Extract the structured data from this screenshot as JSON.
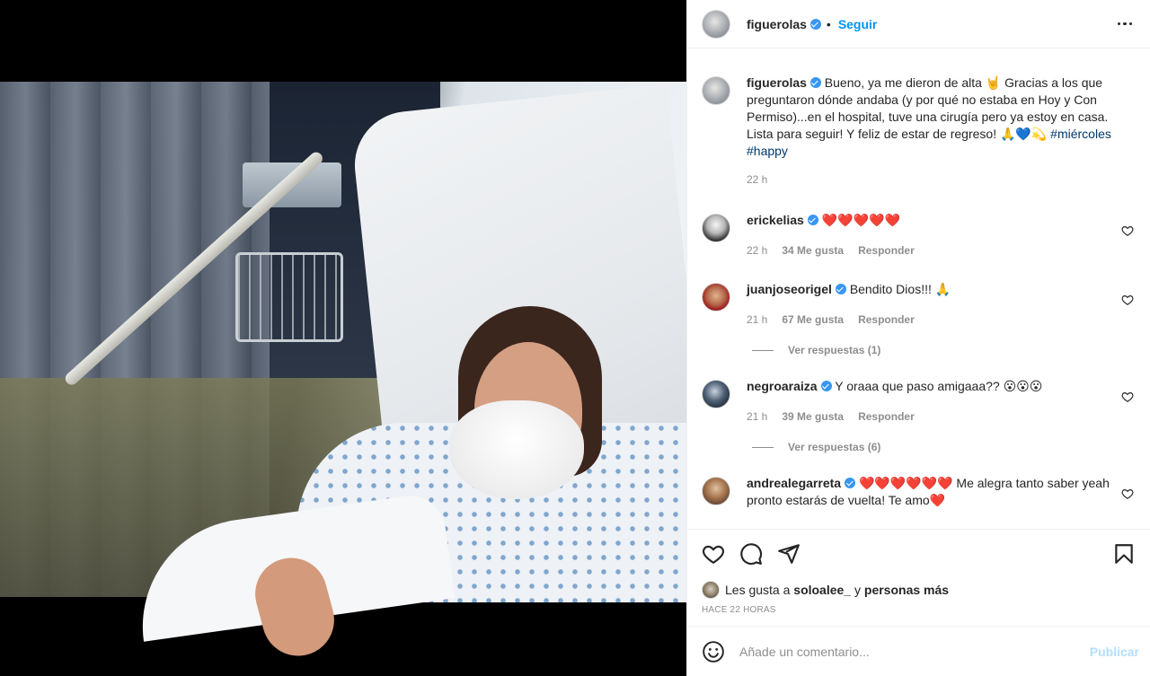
{
  "post": {
    "author": "figuerolas",
    "follow_label": "Seguir",
    "separator": "•",
    "caption_text": "Bueno, ya me dieron de alta 🤘 Gracias a los que preguntaron dónde andaba (y por qué no estaba en Hoy y Con Permiso)...en el hospital, tuve una cirugía pero ya estoy en casa. Lista para seguir! Y feliz de estar de regreso! 🙏💙💫 ",
    "hashtag1": "#miércoles",
    "hashtag2": "#happy",
    "caption_time": "22 h"
  },
  "comments": [
    {
      "user": "erickelias",
      "text": "❤️❤️❤️❤️❤️",
      "time": "22 h",
      "likes": "34 Me gusta",
      "reply": "Responder"
    },
    {
      "user": "juanjoseorigel",
      "text": "Bendito Dios!!! 🙏",
      "time": "21 h",
      "likes": "67 Me gusta",
      "reply": "Responder",
      "replies": "Ver respuestas (1)"
    },
    {
      "user": "negroaraiza",
      "text": "Y oraaa que paso amigaaa?? 😮😮😮",
      "time": "21 h",
      "likes": "39 Me gusta",
      "reply": "Responder",
      "replies": "Ver respuestas (6)"
    },
    {
      "user": "andrealegarreta",
      "text": "❤️❤️❤️❤️❤️❤️ Me alegra tanto saber yeah pronto estarás de vuelta! Te amo❤️"
    }
  ],
  "likes": {
    "prefix": "Les gusta a",
    "user": "soloalee_",
    "conj": "y",
    "others": "personas más"
  },
  "timestamp": "HACE 22 HORAS",
  "add_comment": {
    "placeholder": "Añade un comentario...",
    "publish": "Publicar"
  },
  "colors": {
    "accent": "#0095f6",
    "verified": "#3897f0",
    "hashtag": "#00376b",
    "muted": "#8e8e8e",
    "publish_disabled": "#b2dffc"
  },
  "icons": [
    "more-options-icon",
    "heart-icon",
    "comment-icon",
    "share-icon",
    "bookmark-icon",
    "emoji-icon",
    "verified-badge-icon"
  ]
}
